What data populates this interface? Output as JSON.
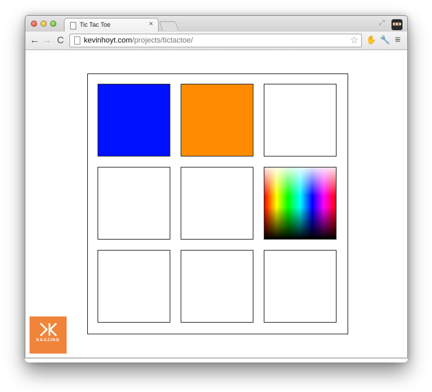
{
  "browser": {
    "tab_title": "Tic Tac Toe",
    "tab_close": "×",
    "url_host": "kevinhoyt.com",
    "url_path": "/projects/tictactoe/"
  },
  "icons": {
    "back": "back-arrow-icon",
    "forward": "forward-arrow-icon",
    "reload": "reload-icon",
    "star": "bookmark-star-icon",
    "extension": "extension-icon",
    "wrench": "wrench-icon",
    "menu": "menu-icon"
  },
  "board": {
    "cells": [
      {
        "state": "filled",
        "color": "#0011ff"
      },
      {
        "state": "filled",
        "color": "#ff8c00"
      },
      {
        "state": "empty"
      },
      {
        "state": "empty"
      },
      {
        "state": "empty"
      },
      {
        "state": "color-picker"
      },
      {
        "state": "empty"
      },
      {
        "state": "empty"
      },
      {
        "state": "empty"
      }
    ]
  },
  "logo": {
    "brand": "KAAZING",
    "color": "#f0843a"
  }
}
